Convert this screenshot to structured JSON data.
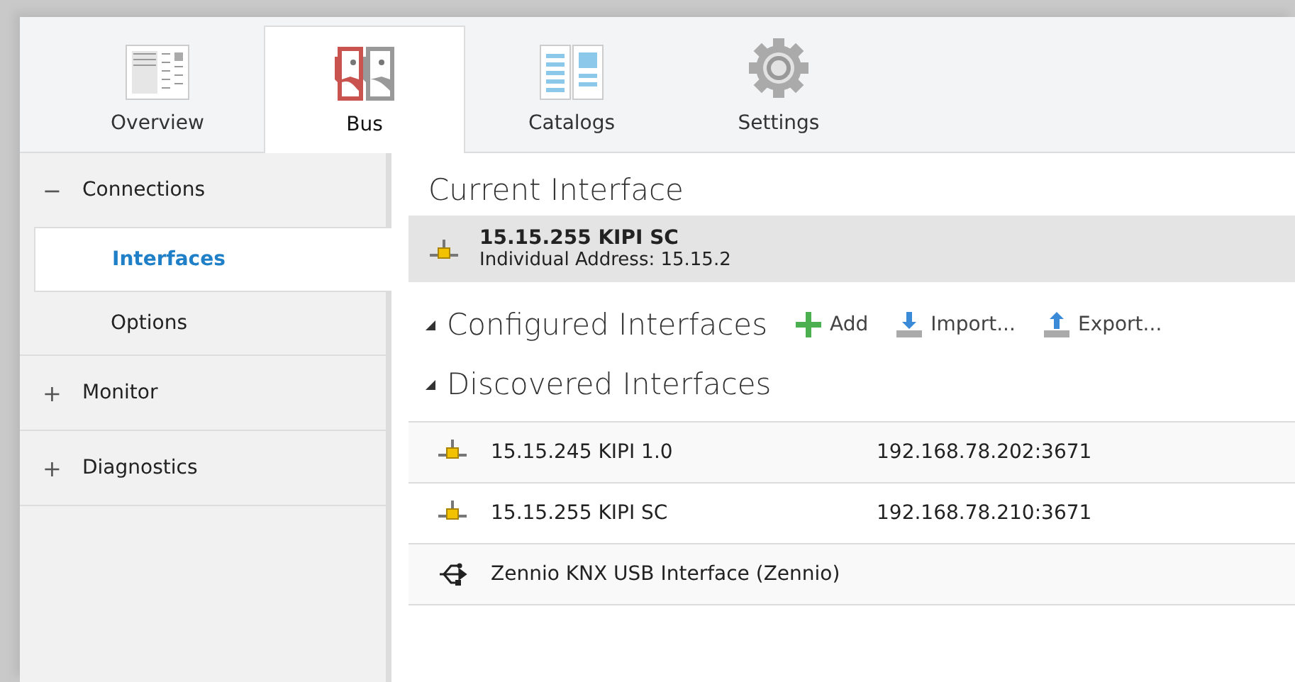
{
  "tabs": [
    {
      "label": "Overview",
      "selected": false
    },
    {
      "label": "Bus",
      "selected": true
    },
    {
      "label": "Catalogs",
      "selected": false
    },
    {
      "label": "Settings",
      "selected": false
    }
  ],
  "sidebar": {
    "items": [
      {
        "toggle": "−",
        "label": "Connections",
        "children": [
          {
            "label": "Interfaces",
            "selected": true
          },
          {
            "label": "Options",
            "selected": false
          }
        ]
      },
      {
        "toggle": "+",
        "label": "Monitor"
      },
      {
        "toggle": "+",
        "label": "Diagnostics"
      }
    ]
  },
  "current_interface": {
    "title": "Current Interface",
    "name": "15.15.255 KIPI SC",
    "address": "Individual Address: 15.15.2"
  },
  "configured_interfaces": {
    "title": "Configured Interfaces",
    "expanded": true,
    "actions": [
      {
        "kind": "add",
        "label": "Add"
      },
      {
        "kind": "import",
        "label": "Import..."
      },
      {
        "kind": "export",
        "label": "Export..."
      }
    ]
  },
  "discovered_interfaces": {
    "title": "Discovered Interfaces",
    "expanded": true,
    "rows": [
      {
        "kind": "ip",
        "name": "15.15.245 KIPI 1.0",
        "address": "192.168.78.202:3671"
      },
      {
        "kind": "ip",
        "name": "15.15.255 KIPI SC",
        "address": "192.168.78.210:3671"
      },
      {
        "kind": "usb",
        "name": "Zennio KNX USB Interface (Zennio)"
      }
    ]
  }
}
